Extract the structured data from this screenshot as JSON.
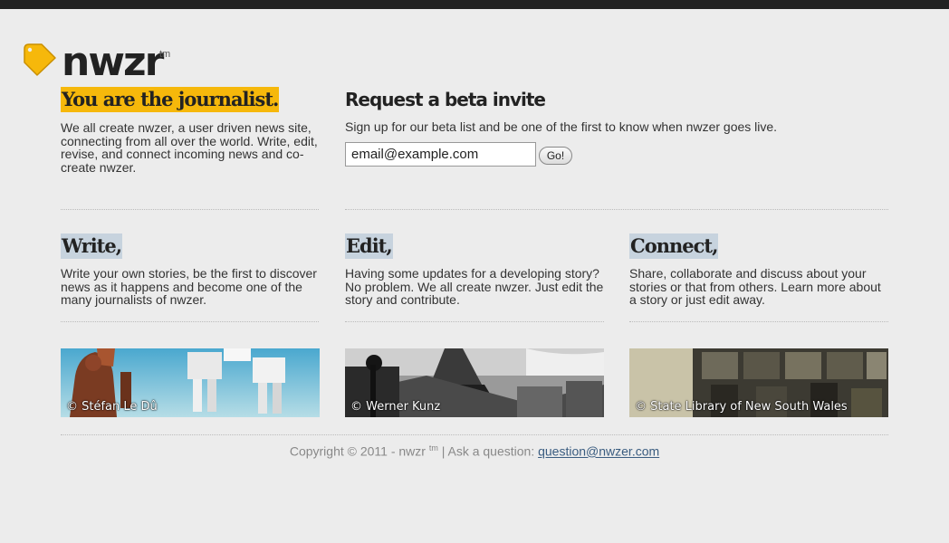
{
  "brand": {
    "name": "nwzr",
    "tm": "tm",
    "tag_color": "#f6b80b"
  },
  "intro": {
    "headline": "You are the journalist.",
    "body": "We all create nwzer, a user driven news site, connecting from all over the world. Write, edit, revise, and connect incoming news and co-create nwzer."
  },
  "invite": {
    "title": "Request a beta invite",
    "body": "Sign up for our beta list and be one of the first to know when nwzer goes live.",
    "email_value": "email@example.com",
    "go_label": "Go!"
  },
  "features": [
    {
      "title": "Write,",
      "body": "Write your own stories, be the first to discover news as it happens and become one of the many journalists of nwzer."
    },
    {
      "title": "Edit,",
      "body": "Having some updates for a developing story? No problem. We all create nwzer. Just edit the story and contribute."
    },
    {
      "title": "Connect,",
      "body": "Share, collaborate and discuss about your stories or that from others. Learn more about a story or just edit away."
    }
  ],
  "photos": [
    {
      "credit": "© Stéfan Le Dû"
    },
    {
      "credit": "© Werner Kunz"
    },
    {
      "credit": "© State Library of New South Wales"
    }
  ],
  "footer": {
    "copyright": "Copyright © 2011 - nwzr",
    "tm": "tm",
    "ask": "| Ask a question:",
    "email": "question@nwzer.com"
  }
}
